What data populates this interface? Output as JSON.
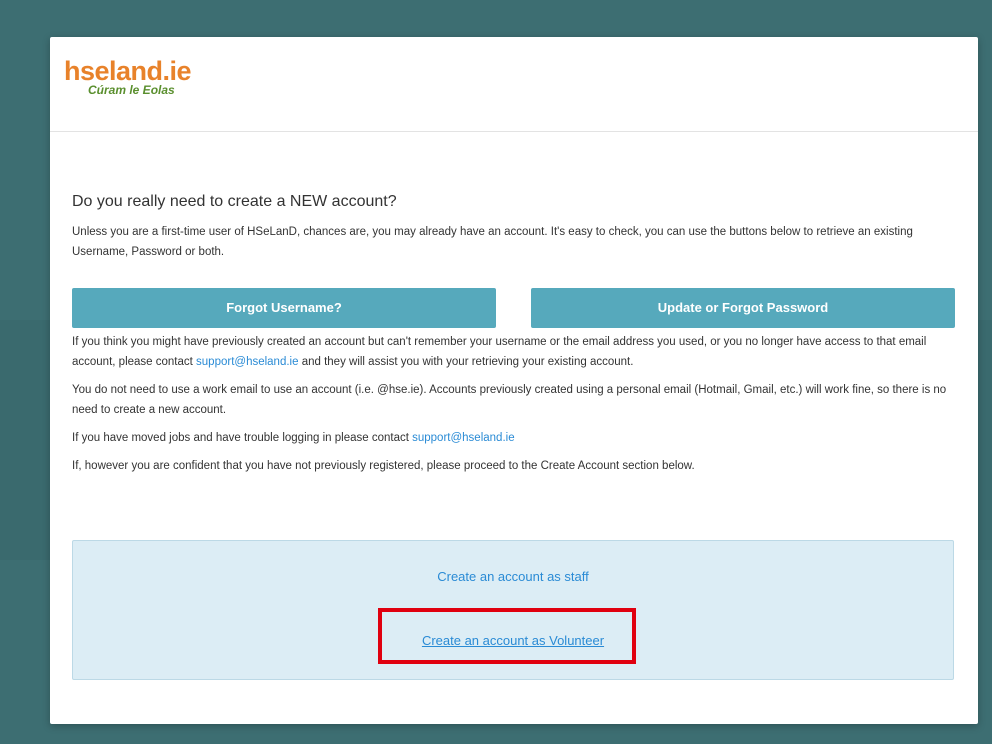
{
  "logo": {
    "brand_prefix": "hse",
    "brand_mid": "land",
    "brand_suffix": ".ie",
    "tagline": "Cúram le Eolas"
  },
  "main": {
    "heading": "Do you really need to create a NEW account?",
    "intro": "Unless you are a first-time user of HSeLanD, chances are, you may already have an account. It's easy to check, you can use the buttons below to retrieve an existing Username, Password or both.",
    "forgot_username_label": "Forgot Username?",
    "forgot_password_label": "Update or Forgot Password",
    "para1_before": "If you think you might have previously created an account but can't remember your username or the email address you used, or you no longer have access to that email account, please contact ",
    "para1_link": "support@hseland.ie",
    "para1_after": " and they will assist you with your retrieving your existing account.",
    "para2": "You do not need to use a work email to use an account (i.e. @hse.ie). Accounts previously created using a personal email (Hotmail, Gmail, etc.) will work fine, so there is no need to create a new account.",
    "para3_before": "If you have moved jobs and have trouble logging in please contact ",
    "para3_link": "support@hseland.ie",
    "para4": "If, however you are confident that you have not previously registered, please proceed to the Create Account section below."
  },
  "create": {
    "staff_label": "Create an account as staff",
    "volunteer_label": "Create an account as Volunteer"
  },
  "colors": {
    "background": "#3d6e72",
    "button": "#56a9bc",
    "link": "#2a8bd5",
    "create_box": "#dcedf5",
    "highlight": "#e0000f",
    "logo_orange": "#e8822a",
    "logo_green": "#5a8f2e"
  },
  "icons": []
}
